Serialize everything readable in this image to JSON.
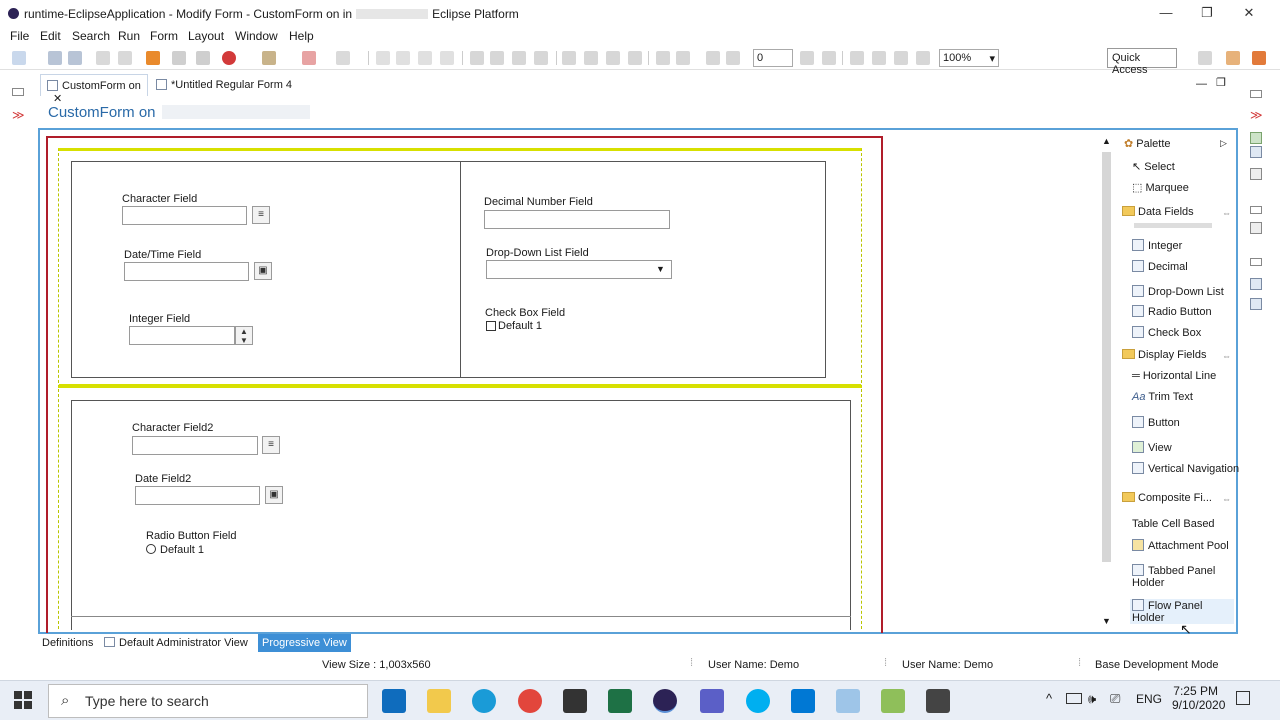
{
  "window": {
    "title": "runtime-EclipseApplication - Modify Form - CustomForm on in",
    "title_suffix": "Eclipse Platform"
  },
  "menu": [
    "File",
    "Edit",
    "Search",
    "Run",
    "Form",
    "Layout",
    "Window",
    "Help"
  ],
  "toolbar": {
    "spinner_value": "0",
    "zoom": "100%",
    "quick_access": "Quick Access"
  },
  "editor_tabs": [
    {
      "label": "CustomForm on"
    },
    {
      "label": "*Untitled Regular Form 4"
    }
  ],
  "form_title": "CustomForm on",
  "form": {
    "left_panel": {
      "character_field": "Character Field",
      "datetime_field": "Date/Time Field",
      "integer_field": "Integer Field"
    },
    "right_panel": {
      "decimal_field": "Decimal Number Field",
      "dropdown_field": "Drop-Down List Field",
      "checkbox_field": "Check Box Field",
      "checkbox_option": "Default 1"
    },
    "lower_panel": {
      "character_field2": "Character Field2",
      "date_field2": "Date Field2",
      "radio_field": "Radio Button Field",
      "radio_option": "Default 1"
    }
  },
  "palette": {
    "title": "Palette",
    "tools": [
      "Select",
      "Marquee"
    ],
    "data_fields_label": "Data Fields",
    "data_fields": [
      "Integer",
      "Decimal",
      "Drop-Down List",
      "Radio Button",
      "Check Box"
    ],
    "display_fields_label": "Display Fields",
    "display_fields": [
      "Horizontal Line",
      "Trim Text",
      "Button",
      "View",
      "Vertical Navigation"
    ],
    "composite_label": "Composite Fi...",
    "composite_fields": [
      "Table Cell Based",
      "Attachment Pool",
      "Tabbed Panel Holder",
      "Flow Panel Holder"
    ]
  },
  "bottom_tabs": [
    "Definitions",
    "Default Administrator View",
    "Progressive View"
  ],
  "status": {
    "view_size": "View Size : 1,003x560",
    "user1": "User Name: Demo",
    "user2": "User Name: Demo",
    "mode": "Base Development Mode"
  },
  "taskbar": {
    "search_placeholder": "Type here to search",
    "time": "7:25 PM",
    "date": "9/10/2020",
    "lang": "ENG"
  },
  "colors": {
    "accent": "#2a6aa8",
    "canvas_border": "#b01d2a",
    "panel_highlight": "#d7e000",
    "editor_border": "#5aa1d8",
    "selected_tab": "#3d8fd6"
  }
}
